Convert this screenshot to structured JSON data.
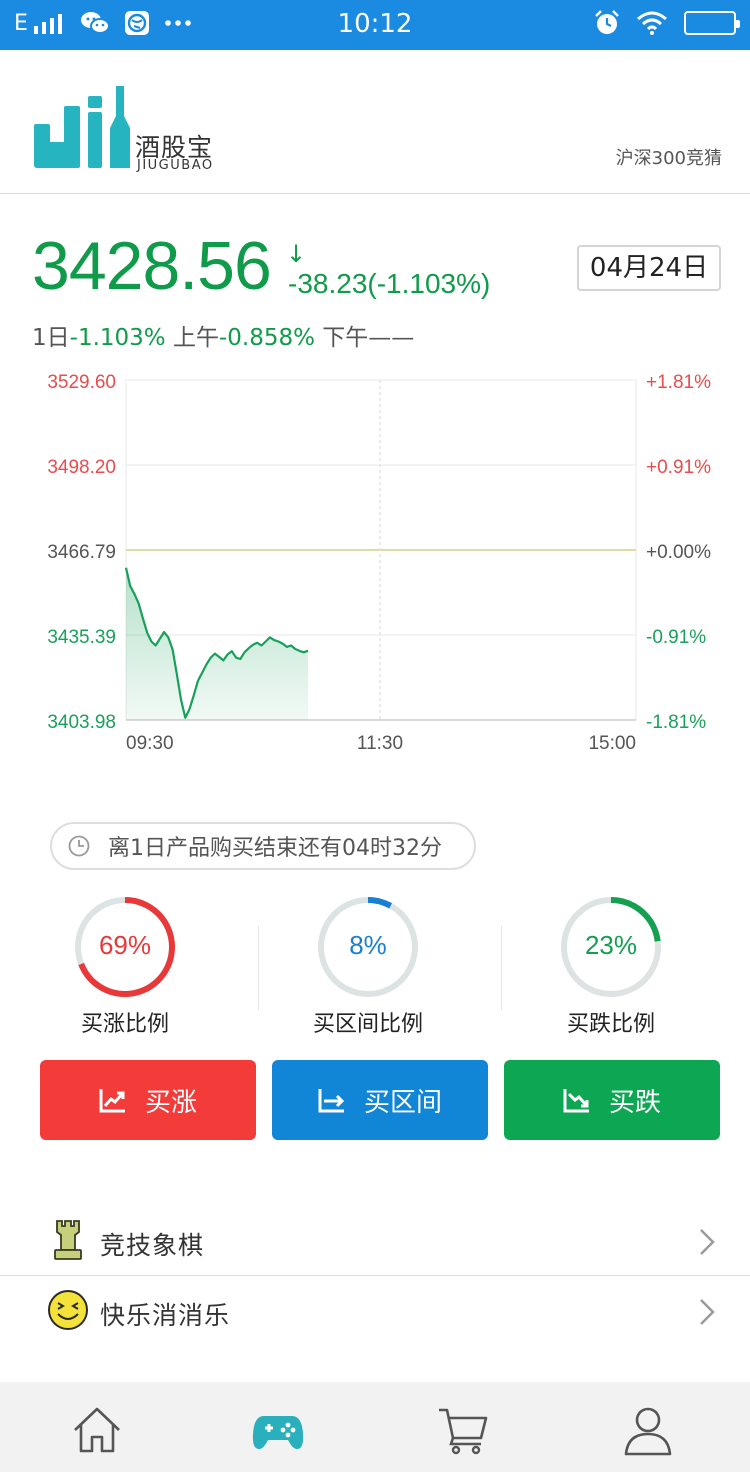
{
  "status_bar": {
    "network": "E",
    "time": "10:12"
  },
  "header": {
    "logo_cn": "酒股宝",
    "logo_en": "JIUGUBAO",
    "right_link": "沪深300竞猜"
  },
  "quote": {
    "price": "3428.56",
    "arrow": "↓",
    "change": "-38.23(-1.103%)",
    "date": "04月24日",
    "summary": {
      "day_label": "1日",
      "day_value": "-1.103%",
      "am_label": "上午",
      "am_value": "-0.858%",
      "pm_label": "下午",
      "pm_value": "——"
    }
  },
  "chart_data": {
    "type": "area",
    "y_left_ticks": [
      "3529.60",
      "3498.20",
      "3466.79",
      "3435.39",
      "3403.98"
    ],
    "y_left_values": [
      3529.6,
      3498.2,
      3466.79,
      3435.39,
      3403.98
    ],
    "y_right_ticks": [
      "+1.81%",
      "+0.91%",
      "+0.00%",
      "-0.91%",
      "-1.81%"
    ],
    "x_ticks": [
      "09:30",
      "11:30",
      "15:00"
    ],
    "baseline": 3466.79,
    "ylim": [
      3403.98,
      3529.6
    ],
    "colors": {
      "up": "#e84c4c",
      "down": "#1aa05a",
      "flat": "#555555",
      "baseline": "#e0dba0",
      "line": "#17a05a"
    },
    "series": [
      {
        "minutes": [
          0,
          2,
          4,
          6,
          8,
          10,
          12,
          14,
          16,
          18,
          20,
          22,
          24,
          26,
          28,
          30,
          32,
          34,
          36,
          38,
          40,
          42,
          44,
          46,
          48,
          50,
          52,
          54,
          56,
          58,
          60,
          62,
          64,
          66,
          68,
          70,
          72,
          74,
          76,
          78,
          80,
          82,
          84,
          86
        ],
        "values": [
          3460.2,
          3453.5,
          3450.5,
          3447.0,
          3441.5,
          3436.2,
          3433.0,
          3431.5,
          3434.0,
          3436.5,
          3434.5,
          3430.0,
          3421.0,
          3411.5,
          3404.8,
          3408.0,
          3413.0,
          3418.5,
          3421.5,
          3424.5,
          3427.0,
          3428.5,
          3427.3,
          3426.0,
          3428.2,
          3429.4,
          3427.0,
          3426.5,
          3429.0,
          3430.5,
          3431.8,
          3432.5,
          3431.5,
          3433.0,
          3434.5,
          3433.5,
          3433.0,
          3432.2,
          3431.0,
          3431.5,
          3430.2,
          3429.5,
          3429.0,
          3429.6
        ]
      }
    ]
  },
  "countdown": {
    "text": "离1日产品购买结束还有04时32分"
  },
  "ratios": [
    {
      "label": "买涨比例",
      "text": "69%",
      "value": 69,
      "color": "#e8393a"
    },
    {
      "label": "买区间比例",
      "text": "8%",
      "value": 8,
      "color": "#1a7fd0"
    },
    {
      "label": "买跌比例",
      "text": "23%",
      "value": 23,
      "color": "#14a04f"
    }
  ],
  "buttons": {
    "buy_up": "买涨",
    "buy_range": "买区间",
    "buy_down": "买跌"
  },
  "list": [
    {
      "label": "竞技象棋",
      "icon": "chess-rook-icon"
    },
    {
      "label": "快乐消消乐",
      "icon": "smiley-icon"
    }
  ],
  "tabs": [
    {
      "icon": "home-icon"
    },
    {
      "icon": "gamepad-icon",
      "active": true,
      "color": "#2ab0bd"
    },
    {
      "icon": "cart-icon"
    },
    {
      "icon": "user-icon"
    }
  ]
}
